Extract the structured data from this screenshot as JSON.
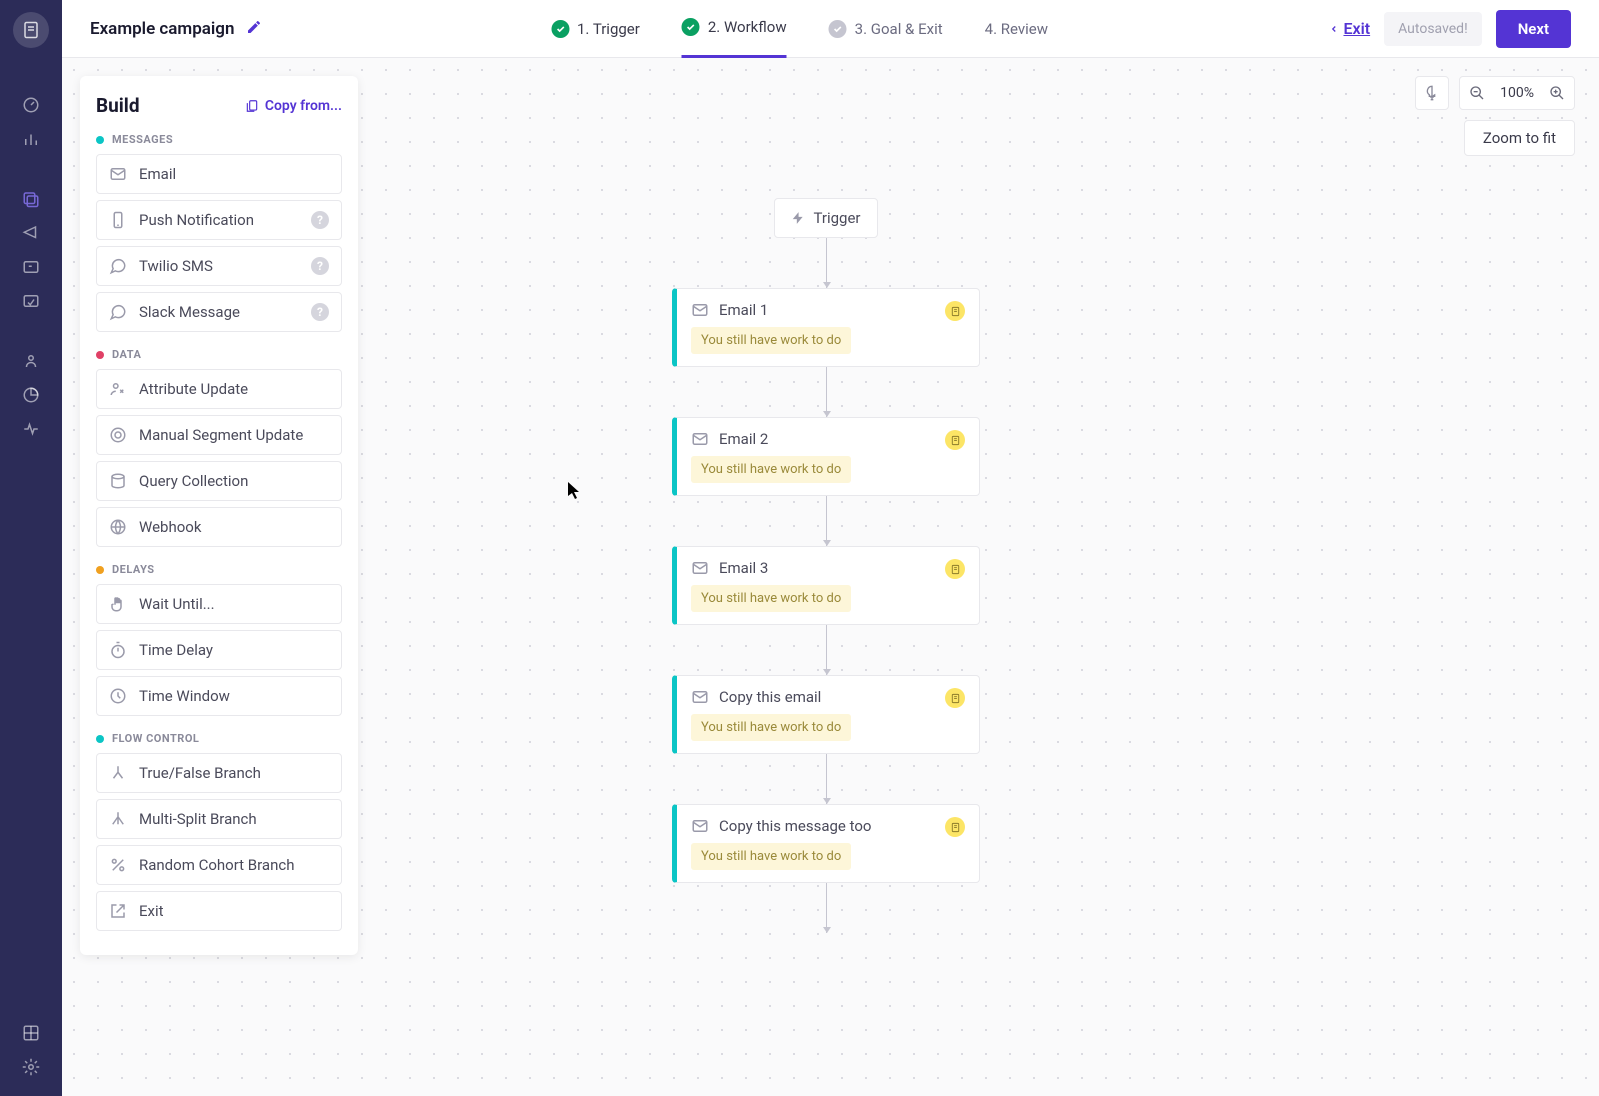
{
  "header": {
    "campaign_title": "Example campaign",
    "exit_label": "Exit",
    "autosaved_label": "Autosaved!",
    "next_label": "Next"
  },
  "steps": [
    {
      "number": "1.",
      "label": "Trigger",
      "state": "done"
    },
    {
      "number": "2.",
      "label": "Workflow",
      "state": "active"
    },
    {
      "number": "3.",
      "label": "Goal & Exit",
      "state": "pending"
    },
    {
      "number": "4.",
      "label": "Review",
      "state": "plain"
    }
  ],
  "build": {
    "title": "Build",
    "copy_from_label": "Copy from...",
    "sections": {
      "messages": {
        "label": "MESSAGES",
        "items": [
          {
            "label": "Email",
            "icon": "envelope",
            "help": false
          },
          {
            "label": "Push Notification",
            "icon": "phone",
            "help": true
          },
          {
            "label": "Twilio SMS",
            "icon": "chat",
            "help": true
          },
          {
            "label": "Slack Message",
            "icon": "chat",
            "help": true
          }
        ]
      },
      "data": {
        "label": "DATA",
        "items": [
          {
            "label": "Attribute Update",
            "icon": "person",
            "help": false
          },
          {
            "label": "Manual Segment Update",
            "icon": "target",
            "help": false
          },
          {
            "label": "Query Collection",
            "icon": "database",
            "help": false
          },
          {
            "label": "Webhook",
            "icon": "globe",
            "help": false
          }
        ]
      },
      "delays": {
        "label": "DELAYS",
        "items": [
          {
            "label": "Wait Until...",
            "icon": "hand",
            "help": false
          },
          {
            "label": "Time Delay",
            "icon": "stopwatch",
            "help": false
          },
          {
            "label": "Time Window",
            "icon": "clock",
            "help": false
          }
        ]
      },
      "flow": {
        "label": "FLOW CONTROL",
        "items": [
          {
            "label": "True/False Branch",
            "icon": "branch2",
            "help": false
          },
          {
            "label": "Multi-Split Branch",
            "icon": "branch3",
            "help": false
          },
          {
            "label": "Random Cohort Branch",
            "icon": "percent",
            "help": false
          },
          {
            "label": "Exit",
            "icon": "exit",
            "help": false
          }
        ]
      }
    }
  },
  "canvas": {
    "zoom_value": "100%",
    "zoom_fit_label": "Zoom to fit"
  },
  "workflow": {
    "trigger_label": "Trigger",
    "warning_text": "You still have work to do",
    "nodes": [
      {
        "title": "Email 1"
      },
      {
        "title": "Email 2"
      },
      {
        "title": "Email 3"
      },
      {
        "title": "Copy this email"
      },
      {
        "title": "Copy this message too"
      }
    ]
  }
}
